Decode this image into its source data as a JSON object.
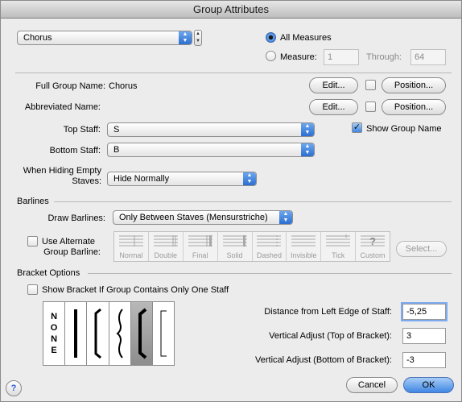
{
  "window": {
    "title": "Group Attributes"
  },
  "group": {
    "selected": "Chorus"
  },
  "measures": {
    "all_label": "All Measures",
    "measure_label": "Measure:",
    "measure_value": "1",
    "through_label": "Through:",
    "through_value": "64",
    "selected": "all"
  },
  "names": {
    "full_label": "Full Group Name:",
    "full_value": "Chorus",
    "abbr_label": "Abbreviated Name:",
    "edit_label": "Edit...",
    "position_label": "Position..."
  },
  "staves": {
    "top_label": "Top Staff:",
    "top_value": "S",
    "bottom_label": "Bottom Staff:",
    "bottom_value": "B",
    "show_group_name_label": "Show Group Name",
    "show_group_name": true
  },
  "hiding": {
    "label_line1": "When Hiding Empty",
    "label_line2": "Staves:",
    "value": "Hide Normally"
  },
  "barlines": {
    "section_title": "Barlines",
    "draw_label": "Draw Barlines:",
    "draw_value": "Only Between Staves (Mensurstriche)",
    "alt_label_line1": "Use Alternate",
    "alt_label_line2": "Group Barline:",
    "alt_checked": false,
    "styles": [
      "Normal",
      "Double",
      "Final",
      "Solid",
      "Dashed",
      "Invisible",
      "Tick",
      "Custom"
    ],
    "select_label": "Select..."
  },
  "bracket": {
    "section_title": "Bracket Options",
    "show_if_one_label": "Show Bracket If Group Contains Only One Staff",
    "show_if_one": false,
    "none_text": [
      "N",
      "O",
      "N",
      "E"
    ],
    "selected_index": 4,
    "distance_label": "Distance from Left Edge of Staff:",
    "distance_value": "-5,25",
    "vtop_label": "Vertical Adjust (Top of Bracket):",
    "vtop_value": "3",
    "vbottom_label": "Vertical Adjust (Bottom of Bracket):",
    "vbottom_value": "-3"
  },
  "footer": {
    "help": "?",
    "cancel_label": "Cancel",
    "ok_label": "OK"
  }
}
